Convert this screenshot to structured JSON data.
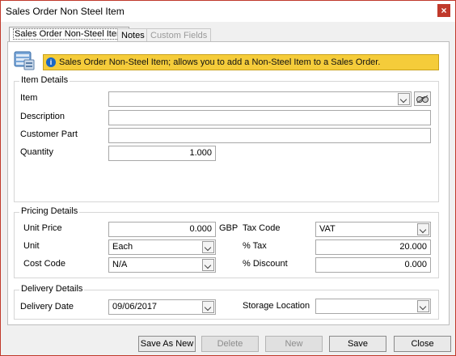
{
  "window": {
    "title": "Sales Order Non Steel Item",
    "close_symbol": "×"
  },
  "tabs": [
    {
      "label": "Sales Order Non-Steel Item",
      "state": "active"
    },
    {
      "label": "Notes",
      "state": "normal"
    },
    {
      "label": "Custom Fields",
      "state": "disabled"
    }
  ],
  "banner": {
    "info_symbol": "i",
    "text": "Sales Order Non-Steel Item; allows you to add a Non-Steel Item to a Sales Order.",
    "color": "#f5cc3a"
  },
  "item_details": {
    "title": "Item Details",
    "item_label": "Item",
    "item_value": "",
    "description_label": "Description",
    "description_value": "",
    "customer_part_label": "Customer Part",
    "customer_part_value": "",
    "quantity_label": "Quantity",
    "quantity_value": "1.000"
  },
  "pricing_details": {
    "title": "Pricing Details",
    "unit_price_label": "Unit Price",
    "unit_price_value": "0.000",
    "currency": "GBP",
    "unit_label": "Unit",
    "unit_value": "Each",
    "cost_code_label": "Cost Code",
    "cost_code_value": "N/A",
    "tax_code_label": "Tax Code",
    "tax_code_value": "VAT",
    "tax_pct_label": "% Tax",
    "tax_pct_value": "20.000",
    "discount_label": "% Discount",
    "discount_value": "0.000"
  },
  "delivery_details": {
    "title": "Delivery Details",
    "delivery_date_label": "Delivery Date",
    "delivery_date_value": "09/06/2017",
    "storage_location_label": "Storage Location",
    "storage_location_value": ""
  },
  "buttons": {
    "save_as_new": "Save As New",
    "delete": "Delete",
    "new": "New",
    "save": "Save",
    "close": "Close"
  },
  "icons": {
    "window_close": "close-icon",
    "banner": "info-icon",
    "app": "database-icon",
    "lookup": "binoculars-icon",
    "dropdown": "chevron-down-icon"
  }
}
